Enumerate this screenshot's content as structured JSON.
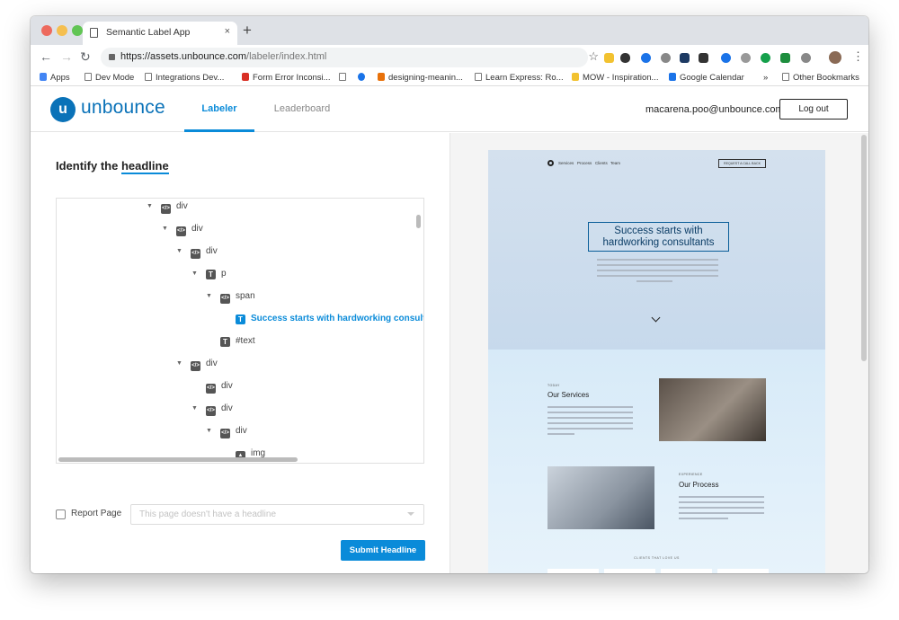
{
  "browser": {
    "tab_title": "Semantic Label App",
    "tab_close": "×",
    "new_tab": "+",
    "url_host": "https://assets.unbounce.com",
    "url_path": "/labeler/index.html"
  },
  "bookmarks": [
    "Apps",
    "Dev Mode",
    "Integrations Dev...",
    "Form Error Inconsi...",
    "designing-meanin...",
    "Learn Express: Ro...",
    "MOW - Inspiration...",
    "Google Calendar",
    "Other Bookmarks"
  ],
  "bookmarks_more": "»",
  "app": {
    "brand": "unbounce",
    "nav": {
      "labeler": "Labeler",
      "leaderboard": "Leaderboard"
    },
    "user_email": "macarena.poo@unbounce.com",
    "logout": "Log out"
  },
  "labeler": {
    "prompt": "Identify the",
    "target": "headline",
    "tree": [
      {
        "icon": "code",
        "label": "div",
        "level": 0,
        "expanded": true
      },
      {
        "icon": "code",
        "label": "div",
        "level": 1,
        "expanded": true
      },
      {
        "icon": "code",
        "label": "div",
        "level": 2,
        "expanded": true
      },
      {
        "icon": "text",
        "label": "p",
        "level": 3,
        "expanded": true
      },
      {
        "icon": "code",
        "label": "span",
        "level": 4,
        "expanded": true
      },
      {
        "icon": "text",
        "label": "Success starts with hardworking consultants",
        "level": 5,
        "selected": true
      },
      {
        "icon": "text",
        "label": "#text",
        "level": 4
      },
      {
        "icon": "code",
        "label": "div",
        "level": 2,
        "expanded": true
      },
      {
        "icon": "code",
        "label": "div",
        "level": 3
      },
      {
        "icon": "code",
        "label": "div",
        "level": 3,
        "expanded": true
      },
      {
        "icon": "code",
        "label": "div",
        "level": 4,
        "expanded": true
      },
      {
        "icon": "image",
        "label": "img",
        "level": 5
      }
    ],
    "report_label": "Report Page",
    "report_placeholder": "This page doesn't have a headline",
    "submit": "Submit Headline"
  },
  "preview": {
    "nav": [
      "Services",
      "Process",
      "Clients",
      "Team"
    ],
    "cta": "REQUEST A CALL BACK",
    "headline": "Success starts with hardworking consultants",
    "services_kicker": "TODAY",
    "services_title": "Our Services",
    "process_kicker": "EXPERIENCE",
    "process_title": "Our Process",
    "clients_label": "CLIENTS THAT LOVE US"
  },
  "colors": {
    "accent": "#0a8bd9",
    "brand": "#0a72b8"
  }
}
